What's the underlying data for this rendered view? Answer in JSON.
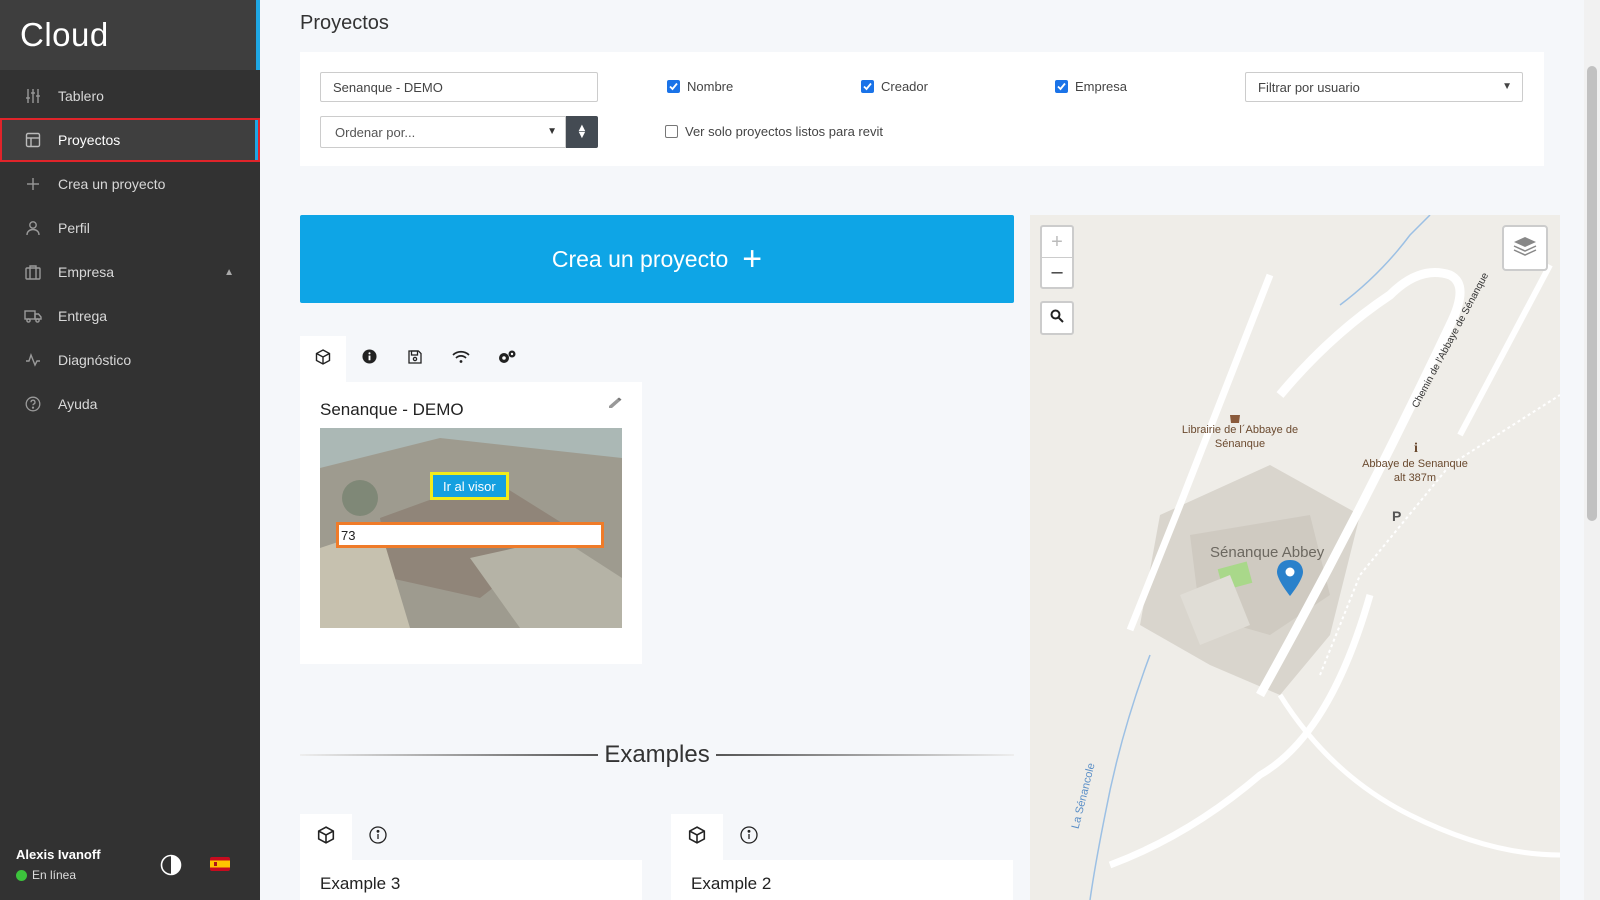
{
  "sidebar": {
    "brand": "Cloud",
    "items": [
      {
        "label": "Tablero",
        "icon": "sliders-icon"
      },
      {
        "label": "Proyectos",
        "icon": "layout-icon",
        "active": true
      },
      {
        "label": "Crea un proyecto",
        "icon": "plus-icon"
      },
      {
        "label": "Perfil",
        "icon": "user-icon"
      },
      {
        "label": "Empresa",
        "icon": "building-icon",
        "expandable": true
      },
      {
        "label": "Entrega",
        "icon": "truck-icon"
      },
      {
        "label": "Diagnóstico",
        "icon": "activity-icon"
      },
      {
        "label": "Ayuda",
        "icon": "help-icon"
      }
    ],
    "user": {
      "name": "Alexis Ivanoff",
      "status": "En línea"
    },
    "accent_color": "#1ea7e4"
  },
  "header": {
    "title": "Proyectos"
  },
  "filters": {
    "search_value": "Senanque - DEMO",
    "sort_placeholder": "Ordenar por...",
    "checks": [
      {
        "label": "Nombre",
        "checked": true
      },
      {
        "label": "Creador",
        "checked": true
      },
      {
        "label": "Empresa",
        "checked": true
      }
    ],
    "revit_only": {
      "label": "Ver solo proyectos listos para revit",
      "checked": false
    },
    "user_filter": "Filtrar por usuario"
  },
  "create_button": {
    "label": "Crea un proyecto",
    "color": "#0ea5e6"
  },
  "project_card": {
    "title": "Senanque - DEMO",
    "viewer_button": "Ir al visor",
    "input_value": "73",
    "tabs": [
      "cube-icon",
      "info-icon",
      "save-icon",
      "wifi-icon",
      "settings-icon"
    ]
  },
  "examples": {
    "title": "Examples",
    "cards": [
      {
        "title": "Example 3"
      },
      {
        "title": "Example 2"
      }
    ]
  },
  "map": {
    "labels": {
      "bookshop": "Librairie de l´Abbaye de Sénanque",
      "abbey_info": "Abbaye de Senanque alt 387m",
      "abbey": "Sénanque Abbey",
      "road": "Chemin de l'Abbaye de Sénanque",
      "river": "La Sénancole",
      "parking": "P"
    }
  }
}
